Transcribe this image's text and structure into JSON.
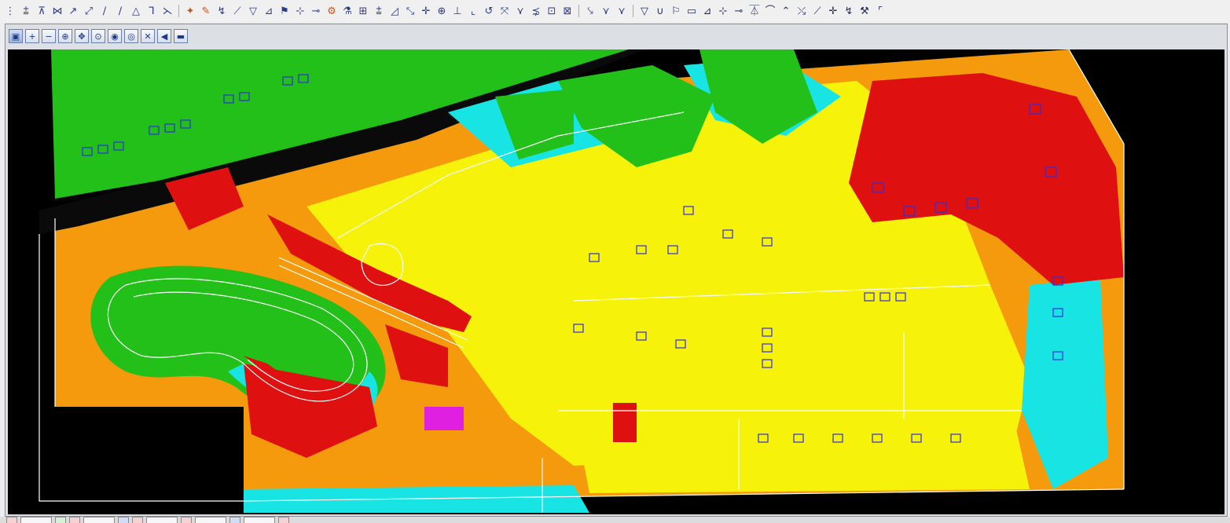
{
  "toolbar": {
    "tools": [
      {
        "glyph": "⋮",
        "icon": "grip-icon"
      },
      {
        "glyph": "⩲",
        "icon": "place-line-icon"
      },
      {
        "glyph": "⊼",
        "icon": "arc-icon"
      },
      {
        "glyph": "⋈",
        "icon": "intersect-icon"
      },
      {
        "glyph": "↗",
        "icon": "extend-icon"
      },
      {
        "glyph": "⤢",
        "icon": "fillet-icon"
      },
      {
        "glyph": "∕",
        "icon": "line-icon"
      },
      {
        "glyph": "∕",
        "icon": "line-2-icon"
      },
      {
        "glyph": "△",
        "icon": "triangle-icon"
      },
      {
        "glyph": "⅂",
        "icon": "offset-icon"
      },
      {
        "glyph": "⋋",
        "icon": "chamfer-icon"
      },
      {
        "sep": true
      },
      {
        "glyph": "✦",
        "icon": "point-icon",
        "tone": "warm"
      },
      {
        "glyph": "✎",
        "icon": "edit-icon",
        "tone": "warm"
      },
      {
        "glyph": "↯",
        "icon": "break-icon"
      },
      {
        "glyph": "⟋",
        "icon": "slope-icon"
      },
      {
        "glyph": "▽",
        "icon": "drop-icon"
      },
      {
        "glyph": "⊿",
        "icon": "right-angle-icon"
      },
      {
        "glyph": "⚑",
        "icon": "flag-icon"
      },
      {
        "glyph": "⊹",
        "icon": "cross-icon"
      },
      {
        "glyph": "⊸",
        "icon": "pipe-icon"
      },
      {
        "glyph": "⚙",
        "icon": "settings-icon",
        "tone": "warm"
      },
      {
        "glyph": "⚗",
        "icon": "analyze-icon"
      },
      {
        "glyph": "⊞",
        "icon": "grid-icon"
      },
      {
        "glyph": "⩲",
        "icon": "level-icon"
      },
      {
        "glyph": "◿",
        "icon": "corner-icon"
      },
      {
        "glyph": "⤡",
        "icon": "stretch-icon"
      },
      {
        "glyph": "✛",
        "icon": "plus-icon"
      },
      {
        "glyph": "⊕",
        "icon": "node-icon"
      },
      {
        "glyph": "⊥",
        "icon": "perpendicular-icon"
      },
      {
        "glyph": "⌞",
        "icon": "bracket-icon"
      },
      {
        "glyph": "↺",
        "icon": "rotate-icon"
      },
      {
        "glyph": "⤧",
        "icon": "divide-icon"
      },
      {
        "glyph": "⋎",
        "icon": "vertex-icon"
      },
      {
        "glyph": "⋨",
        "icon": "merge-icon"
      },
      {
        "glyph": "⊡",
        "icon": "select-icon"
      },
      {
        "glyph": "⊠",
        "icon": "deselect-icon"
      },
      {
        "sep": true
      },
      {
        "glyph": "⤥",
        "icon": "trim-icon"
      },
      {
        "glyph": "⋎",
        "icon": "vertex-2-icon"
      },
      {
        "glyph": "⋎",
        "icon": "vertex-3-icon"
      },
      {
        "sep": true
      },
      {
        "glyph": "▽",
        "icon": "drape-icon",
        "tone": "dark"
      },
      {
        "glyph": "∪",
        "icon": "union-icon",
        "tone": "dark"
      },
      {
        "glyph": "⚐",
        "icon": "flag-2-icon",
        "tone": "dark"
      },
      {
        "glyph": "▭",
        "icon": "rectangle-icon",
        "tone": "dark"
      },
      {
        "glyph": "⊿",
        "icon": "slope-2-icon",
        "tone": "dark"
      },
      {
        "glyph": "⊹",
        "icon": "cross-2-icon",
        "tone": "dark"
      },
      {
        "glyph": "⊸",
        "icon": "pipe-2-icon",
        "tone": "dark"
      },
      {
        "glyph": "⏄",
        "icon": "step-icon",
        "tone": "dark"
      },
      {
        "glyph": "⌒",
        "icon": "curve-icon",
        "tone": "dark"
      },
      {
        "glyph": "⌃",
        "icon": "peak-icon",
        "tone": "dark"
      },
      {
        "glyph": "⤯",
        "icon": "cross-slope-icon",
        "tone": "dark"
      },
      {
        "glyph": "⟋",
        "icon": "slope-3-icon",
        "tone": "dark"
      },
      {
        "glyph": "✛",
        "icon": "plus-2-icon",
        "tone": "dark"
      },
      {
        "glyph": "↯",
        "icon": "break-2-icon",
        "tone": "dark"
      },
      {
        "glyph": "⚒",
        "icon": "tools-icon",
        "tone": "dark"
      },
      {
        "glyph": "⌜",
        "icon": "corner-2-icon",
        "tone": "dark"
      }
    ]
  },
  "view_toolbar": {
    "buttons": [
      {
        "glyph": "▣",
        "icon": "view-attributes-icon",
        "active": true
      },
      {
        "glyph": "+",
        "icon": "zoom-in-icon"
      },
      {
        "glyph": "−",
        "icon": "zoom-out-icon"
      },
      {
        "glyph": "⊕",
        "icon": "window-area-icon"
      },
      {
        "glyph": "✥",
        "icon": "pan-view-icon"
      },
      {
        "glyph": "⊙",
        "icon": "fit-view-icon"
      },
      {
        "glyph": "◉",
        "icon": "zoom-view-icon"
      },
      {
        "glyph": "◎",
        "icon": "view-previous-icon"
      },
      {
        "glyph": "✕",
        "icon": "rotate-view-icon"
      },
      {
        "glyph": "◀",
        "icon": "view-next-icon"
      },
      {
        "glyph": "▬",
        "icon": "view-properties-icon"
      }
    ]
  },
  "view_tabs": [
    {
      "w": false,
      "tone": "c1"
    },
    {
      "w": true,
      "tone": ""
    },
    {
      "w": false,
      "tone": "c2"
    },
    {
      "w": false,
      "tone": "c1"
    },
    {
      "w": true,
      "tone": ""
    },
    {
      "w": false,
      "tone": "c3"
    },
    {
      "w": false,
      "tone": "c1"
    },
    {
      "w": true,
      "tone": ""
    },
    {
      "w": false,
      "tone": "c1"
    },
    {
      "w": true,
      "tone": ""
    },
    {
      "w": false,
      "tone": "c3"
    },
    {
      "w": true,
      "tone": ""
    },
    {
      "w": false,
      "tone": "c1"
    }
  ],
  "map_colors": {
    "background": "#000000",
    "flat_green": "#22c019",
    "mid_yellow": "#f6f20a",
    "moderate_orange": "#f49a0c",
    "steep_red": "#de1010",
    "cyan": "#19e4e4",
    "linework": "#ffffff",
    "building": "#3a3acd",
    "annotation_magenta": "#e020e0"
  }
}
